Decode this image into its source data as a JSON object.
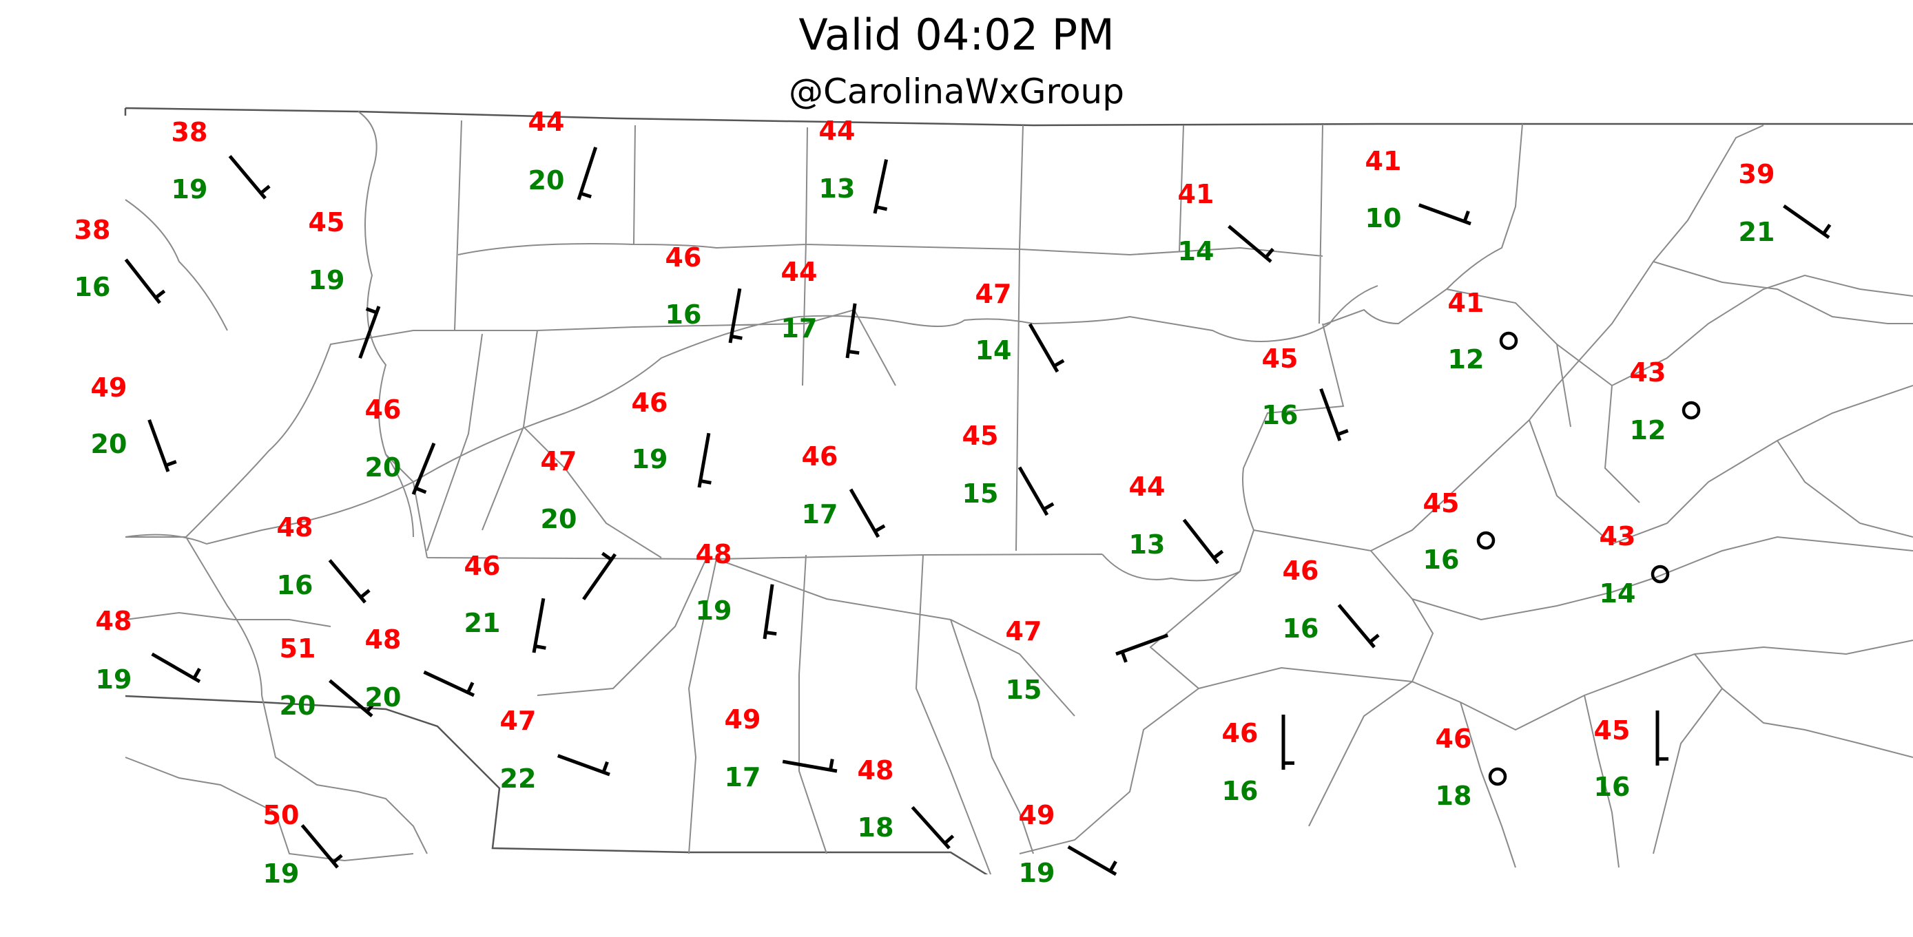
{
  "title": "Valid 04:02 PM",
  "subtitle": "@CarolinaWxGroup",
  "stations": [
    {
      "t": "38",
      "d": "19",
      "wind": "barb"
    },
    {
      "t": "44",
      "d": "20",
      "wind": "barb"
    },
    {
      "t": "44",
      "d": "13",
      "wind": "barb"
    },
    {
      "t": "41",
      "d": "10",
      "wind": "barb"
    },
    {
      "t": "39",
      "d": "21",
      "wind": "barb"
    },
    {
      "t": "38",
      "d": "16",
      "wind": "barb"
    },
    {
      "t": "45",
      "d": "19",
      "wind": "barb"
    },
    {
      "t": "46",
      "d": "16",
      "wind": "barb"
    },
    {
      "t": "44",
      "d": "17",
      "wind": "barb"
    },
    {
      "t": "41",
      "d": "14",
      "wind": "barb"
    },
    {
      "t": "47",
      "d": "14",
      "wind": "barb"
    },
    {
      "t": "41",
      "d": "12",
      "wind": "calm"
    },
    {
      "t": "49",
      "d": "20",
      "wind": "barb"
    },
    {
      "t": "46",
      "d": "20",
      "wind": "barb"
    },
    {
      "t": "46",
      "d": "19",
      "wind": "barb"
    },
    {
      "t": "45",
      "d": "16",
      "wind": "barb"
    },
    {
      "t": "43",
      "d": "12",
      "wind": "calm"
    },
    {
      "t": "47",
      "d": "20",
      "wind": "barb"
    },
    {
      "t": "46",
      "d": "17",
      "wind": "barb"
    },
    {
      "t": "45",
      "d": "15",
      "wind": "barb"
    },
    {
      "t": "44",
      "d": "13",
      "wind": "barb"
    },
    {
      "t": "48",
      "d": "16",
      "wind": "barb"
    },
    {
      "t": "45",
      "d": "16",
      "wind": "calm"
    },
    {
      "t": "43",
      "d": "14",
      "wind": "calm"
    },
    {
      "t": "46",
      "d": "21",
      "wind": "barb"
    },
    {
      "t": "48",
      "d": "19",
      "wind": "barb"
    },
    {
      "t": "46",
      "d": "16",
      "wind": "barb"
    },
    {
      "t": "48",
      "d": "19",
      "wind": "barb"
    },
    {
      "t": "51",
      "d": "20",
      "wind": "barb"
    },
    {
      "t": "48",
      "d": "20",
      "wind": "barb"
    },
    {
      "t": "47",
      "d": "15",
      "wind": "barb"
    },
    {
      "t": "47",
      "d": "22",
      "wind": "barb"
    },
    {
      "t": "49",
      "d": "17",
      "wind": "barb"
    },
    {
      "t": "48",
      "d": "18",
      "wind": "barb"
    },
    {
      "t": "46",
      "d": "16",
      "wind": "barb"
    },
    {
      "t": "46",
      "d": "18",
      "wind": "calm"
    },
    {
      "t": "45",
      "d": "16",
      "wind": "barb"
    },
    {
      "t": "50",
      "d": "19",
      "wind": "barb"
    },
    {
      "t": "49",
      "d": "19",
      "wind": "barb"
    }
  ]
}
